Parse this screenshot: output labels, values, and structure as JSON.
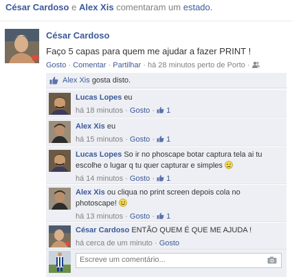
{
  "story": {
    "actor1": "César Cardoso",
    "conj": "e",
    "actor2": "Alex Xis",
    "verb": "comentaram um",
    "object": "estado."
  },
  "post": {
    "author": "César Cardoso",
    "text": "Faço 5 capas para quem me ajudar a fazer PRINT !",
    "like_link": "Gosto",
    "comment_link": "Comentar",
    "share_link": "Partilhar",
    "time": "há 28 minutos perto de Porto",
    "sep": "·",
    "privacy_icon": "friends-icon"
  },
  "likes": {
    "icon": "thumbs-up-icon",
    "name": "Alex Xis",
    "suffix": "gosta disto."
  },
  "comments": [
    {
      "author": "Lucas Lopes",
      "text": "eu",
      "time": "há 18 minutos",
      "like": "Gosto",
      "like_count": "1",
      "emoji": ""
    },
    {
      "author": "Alex Xis",
      "text": "eu",
      "time": "há 15 minutos",
      "like": "Gosto",
      "like_count": "1",
      "emoji": ""
    },
    {
      "author": "Lucas Lopes",
      "text": "So ir no phoscape botar captura tela ai tu escolhe o lugar q tu quer capturar e simples",
      "time": "há 14 minutos",
      "like": "Gosto",
      "like_count": "1",
      "emoji": "worried-emoji"
    },
    {
      "author": "Alex Xis",
      "text": "ou cliqua no print screen depois cola no photoscape!",
      "time": "há 13 minutos",
      "like": "Gosto",
      "like_count": "1",
      "emoji": "smile-emoji"
    },
    {
      "author": "César Cardoso",
      "text": "ENTÃO QUEM É QUE ME AJUDA !",
      "time": "há cerca de um minuto",
      "like": "Gosto",
      "like_count": "",
      "emoji": ""
    }
  ],
  "composer": {
    "placeholder": "Escreve um comentário...",
    "icon": "camera-icon"
  },
  "colors": {
    "link": "#3b5998",
    "meta": "#808080",
    "feedback_bg": "#edeff4"
  }
}
